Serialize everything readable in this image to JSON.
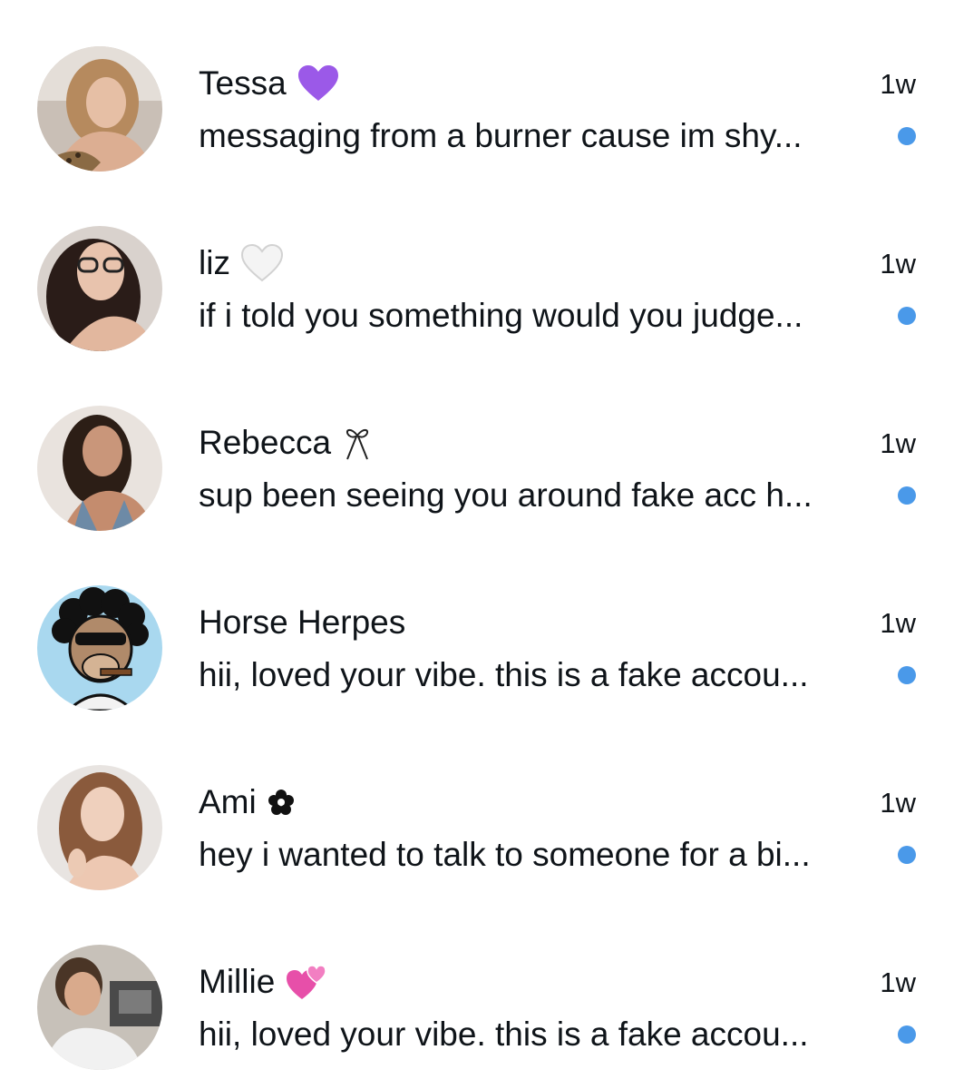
{
  "colors": {
    "unread_dot": "#4a99e9",
    "text": "#0f1419",
    "background": "#ffffff"
  },
  "conversations": [
    {
      "name": "Tessa",
      "badge_icon": "purple-heart-icon",
      "preview": "messaging from a burner cause im shy...",
      "time": "1w",
      "unread": true
    },
    {
      "name": "liz",
      "badge_icon": "white-heart-icon",
      "preview": "if i told you something would you judge...",
      "time": "1w",
      "unread": true
    },
    {
      "name": "Rebecca",
      "badge_icon": "ribbon-icon",
      "preview": "sup been seeing you around fake acc h...",
      "time": "1w",
      "unread": true
    },
    {
      "name": "Horse Herpes",
      "badge_icon": "",
      "preview": "hii, loved your vibe. this is a fake accou...",
      "time": "1w",
      "unread": true
    },
    {
      "name": "Ami",
      "badge_icon": "flower-icon",
      "preview": "hey i wanted to talk to someone for a bi...",
      "time": "1w",
      "unread": true
    },
    {
      "name": "Millie",
      "badge_icon": "two-hearts-icon",
      "preview": "hii, loved your vibe. this is a fake accou...",
      "time": "1w",
      "unread": true
    }
  ]
}
